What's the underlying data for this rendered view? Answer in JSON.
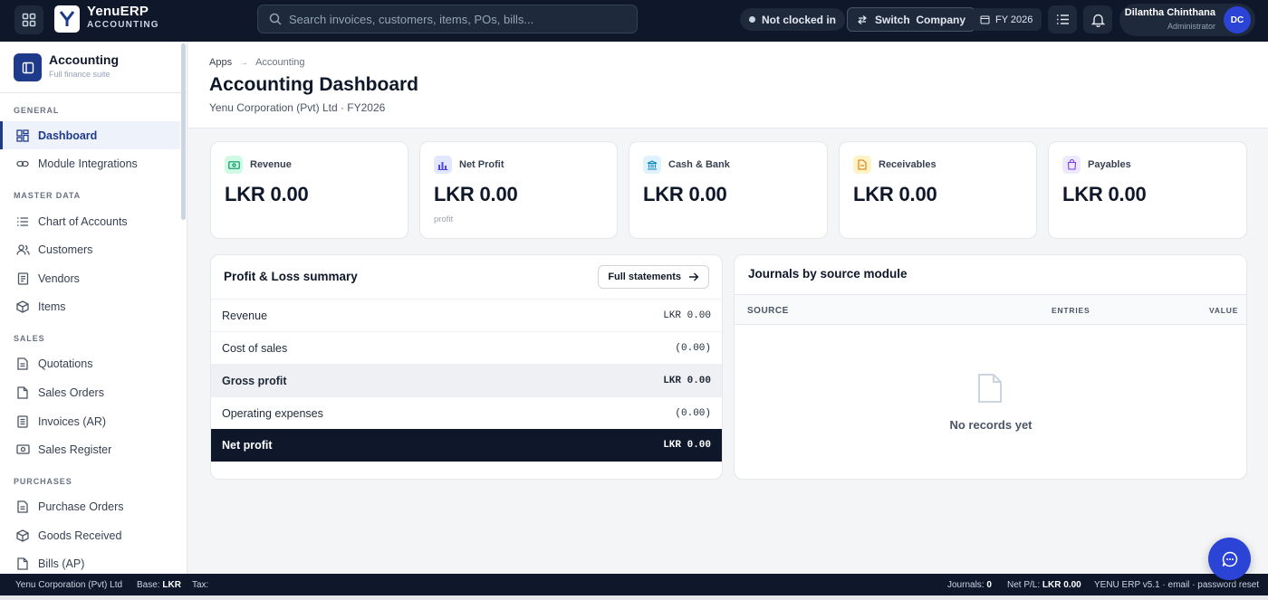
{
  "topbar": {
    "brand": "YenuERP",
    "brand_sub": "ACCOUNTING",
    "search_placeholder": "Search invoices, customers, items, POs, bills...",
    "clock_status": "Not clocked in",
    "switch_company": "Switch  Company",
    "fiscal_year": "FY 2026",
    "user_name": "Dilantha Chinthana",
    "user_role": "Administrator",
    "user_initials": "DC",
    "icons": [
      "apps-grid-icon",
      "list-icon",
      "bell-icon",
      "calendar-icon",
      "swap-icon",
      "search-icon"
    ]
  },
  "sidebar": {
    "title": "Accounting",
    "subtitle": "Full finance suite",
    "sections": {
      "general": "GENERAL",
      "master_data": "MASTER DATA",
      "sales": "SALES",
      "purchases": "PURCHASES"
    },
    "items": {
      "dashboard": "Dashboard",
      "module_integrations": "Module Integrations",
      "chart_of_accounts": "Chart of Accounts",
      "customers": "Customers",
      "vendors": "Vendors",
      "items": "Items",
      "quotations": "Quotations",
      "sales_orders": "Sales Orders",
      "invoices": "Invoices (AR)",
      "sales_register": "Sales Register",
      "purchase_orders": "Purchase Orders",
      "goods_received": "Goods Received",
      "bills": "Bills (AP)"
    },
    "active_item": "dashboard"
  },
  "page": {
    "breadcrumb": [
      "Apps",
      "Accounting"
    ],
    "title": "Accounting Dashboard",
    "subtitle": "Yenu Corporation (Pvt) Ltd · FY2026"
  },
  "kpis": [
    {
      "label": "Revenue",
      "value": "LKR 0.00",
      "sub": "",
      "color": "#10b981"
    },
    {
      "label": "Net Profit",
      "value": "LKR 0.00",
      "sub": "profit",
      "color": "#4f46e5"
    },
    {
      "label": "Cash & Bank",
      "value": "LKR 0.00",
      "sub": "",
      "color": "#0ea5e9"
    },
    {
      "label": "Receivables",
      "value": "LKR 0.00",
      "sub": "",
      "color": "#f59e0b"
    },
    {
      "label": "Payables",
      "value": "LKR 0.00",
      "sub": "",
      "color": "#8b5cf6"
    }
  ],
  "pl_summary": {
    "title": "Profit & Loss summary",
    "button": "Full statements",
    "rows": [
      {
        "label": "Revenue",
        "amount": "LKR 0.00"
      },
      {
        "label": "Cost of sales",
        "amount": "(0.00)"
      },
      {
        "label": "Gross profit",
        "amount": "LKR 0.00"
      },
      {
        "label": "Operating expenses",
        "amount": "(0.00)"
      },
      {
        "label": "Net profit",
        "amount": "LKR 0.00"
      }
    ]
  },
  "journals": {
    "title": "Journals by source module",
    "columns": {
      "source": "SOURCE",
      "entries": "ENTRIES",
      "value": "VALUE"
    },
    "empty_text": "No records yet"
  },
  "statusbar": {
    "company": "Yenu Corporation (Pvt) Ltd",
    "base_label": "Base:",
    "base_value": "LKR",
    "tax_label": "Tax:",
    "journals_label": "Journals:",
    "journals_value": "0",
    "net_pl_label": "Net P/L:",
    "net_pl_value": "LKR 0.00",
    "version": "YENU ERP v5.1 · email · password reset"
  },
  "colors": {
    "navy": "#0f172a",
    "accent": "#2b44d6",
    "active": "#1e3a8a"
  }
}
